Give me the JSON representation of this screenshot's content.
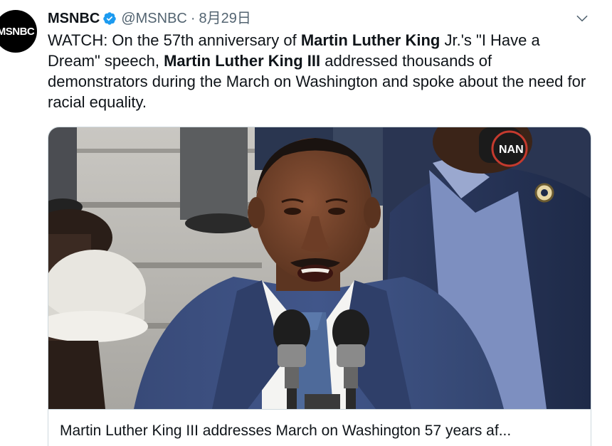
{
  "tweet": {
    "avatar_label": "MSNBC",
    "display_name": "MSNBC",
    "handle": "@MSNBC",
    "separator": "·",
    "date": "8月29日",
    "text": {
      "t1": "WATCH: On the 57th anniversary of ",
      "b1": "Martin Luther King",
      "t2": " Jr.'s \"I Have a Dream\" speech, ",
      "b2": "Martin Luther King III",
      "t3": " addressed thousands of demonstrators during the March on Washington and spoke about the need for racial equality."
    },
    "card": {
      "title": "Martin Luther King III addresses March on Washington 57 years af...",
      "image_badge_text": "NAN"
    }
  },
  "colors": {
    "verified_blue": "#1d9bf0",
    "secondary_text": "#536471",
    "suit_blue": "#2c3e66",
    "skin": "#6b3f2b"
  },
  "icons": {
    "verified": "verified-badge-icon",
    "menu": "chevron-down-icon"
  }
}
